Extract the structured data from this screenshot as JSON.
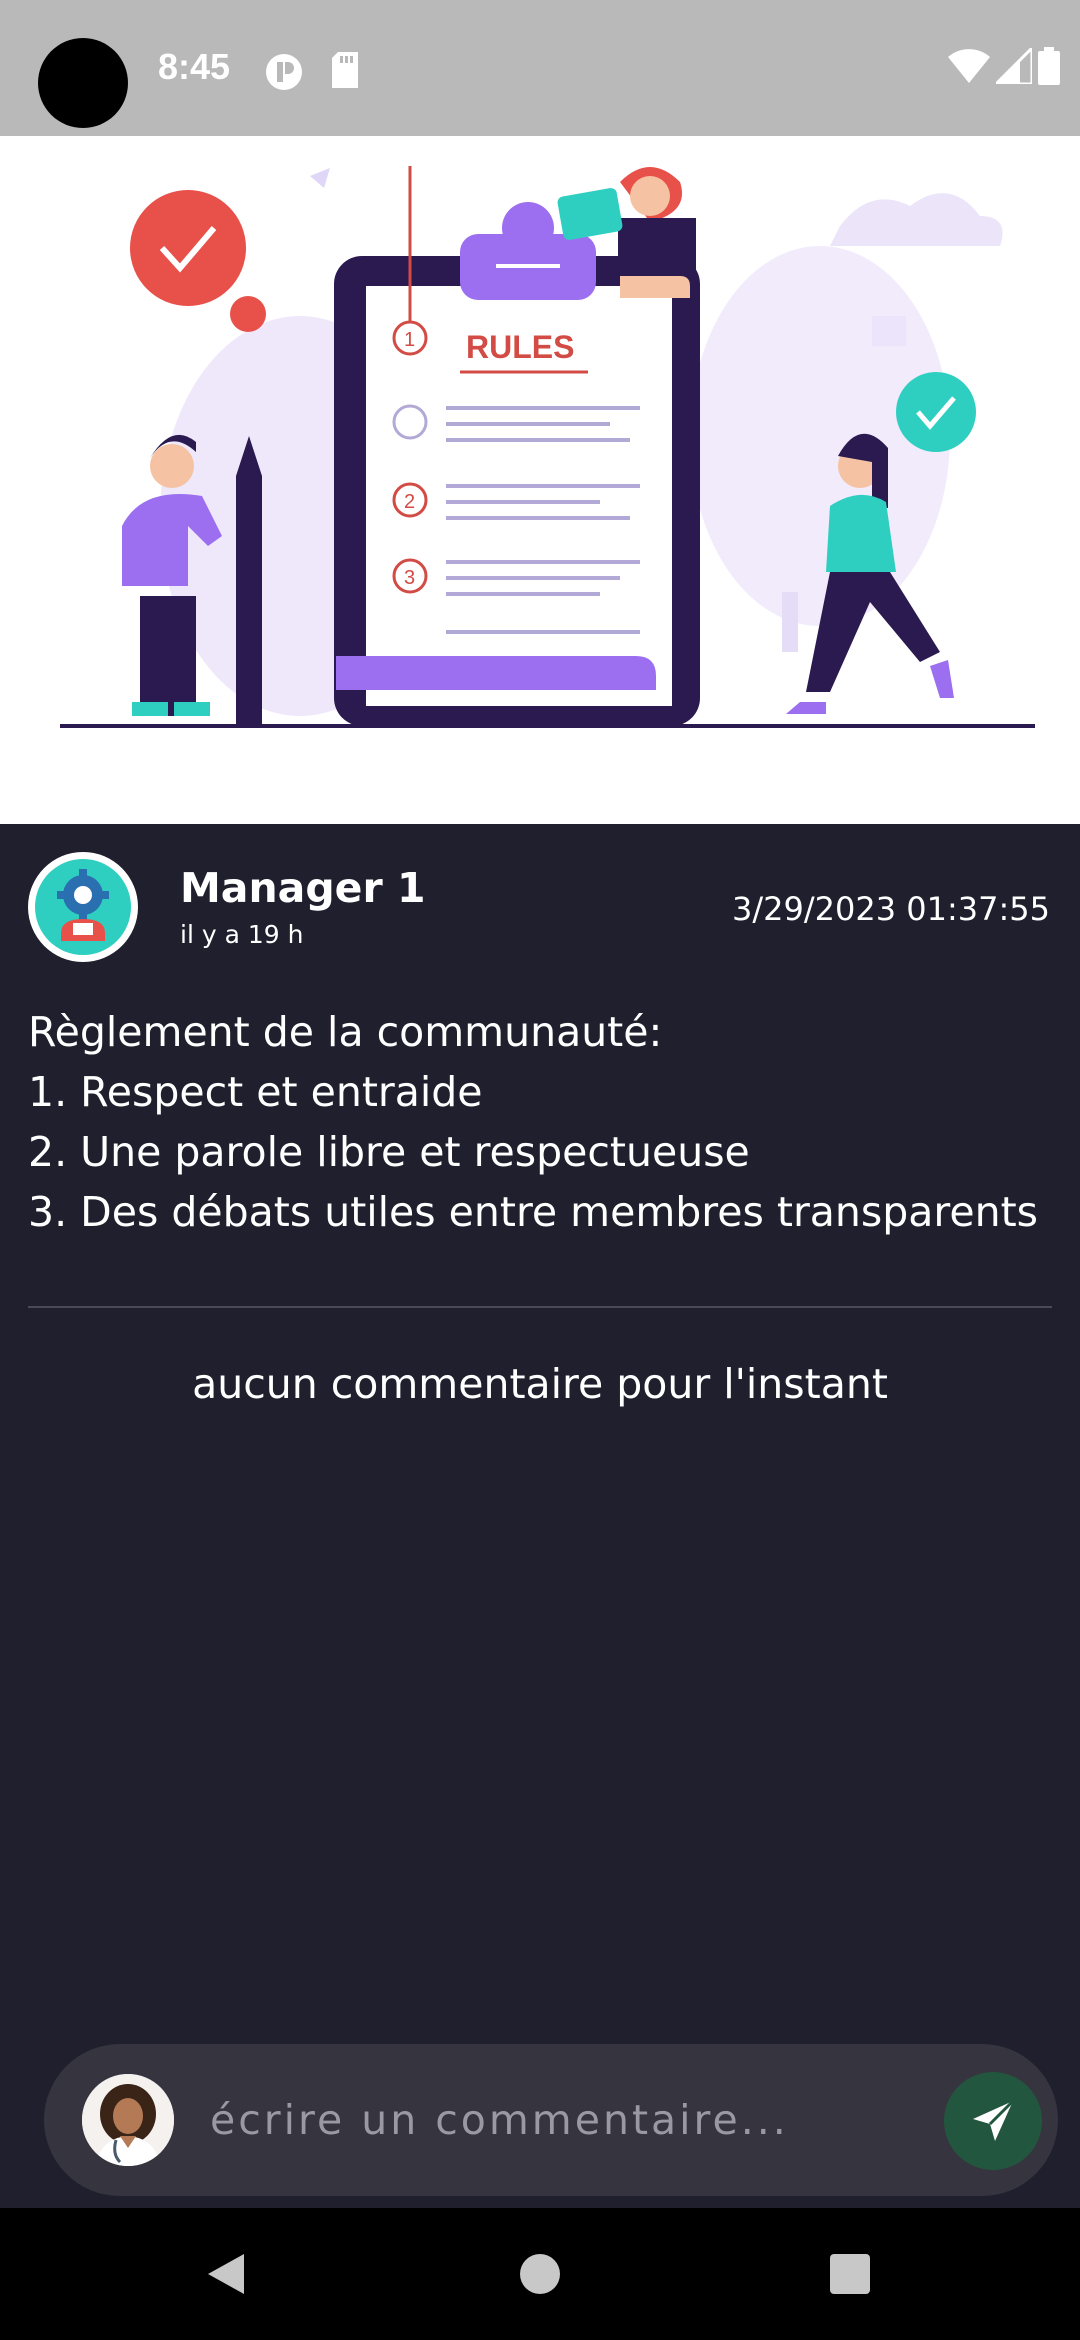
{
  "status_bar": {
    "time": "8:45",
    "icons": [
      "camera-hole-icon",
      "app-notification-icon",
      "sd-card-icon",
      "wifi-icon",
      "signal-icon",
      "battery-icon"
    ]
  },
  "banner": {
    "heading": "RULES",
    "markers": [
      "1",
      "2",
      "3"
    ]
  },
  "post": {
    "author": "Manager 1",
    "ago": "il y a 19 h",
    "date": "3/29/2023 01:37:55",
    "lines": [
      "Règlement de la communauté:",
      "1. Respect et entraide",
      "2. Une parole libre et respectueuse",
      "3. Des débats utiles entre membres transparents"
    ]
  },
  "comments": {
    "empty_text": "aucun commentaire pour l'instant"
  },
  "composer": {
    "placeholder": "écrire un commentaire...",
    "send_icon": "send-icon"
  },
  "nav_bar": {
    "icons": [
      "back-icon",
      "home-icon",
      "recents-icon"
    ]
  },
  "colors": {
    "background": "#201f2d",
    "status_bar": "#b9b9b9",
    "composer": "#36343f",
    "send_button": "#23563f",
    "accent_purple": "#9b6ff0",
    "accent_red": "#e8504a",
    "accent_teal": "#2ecfc0"
  }
}
